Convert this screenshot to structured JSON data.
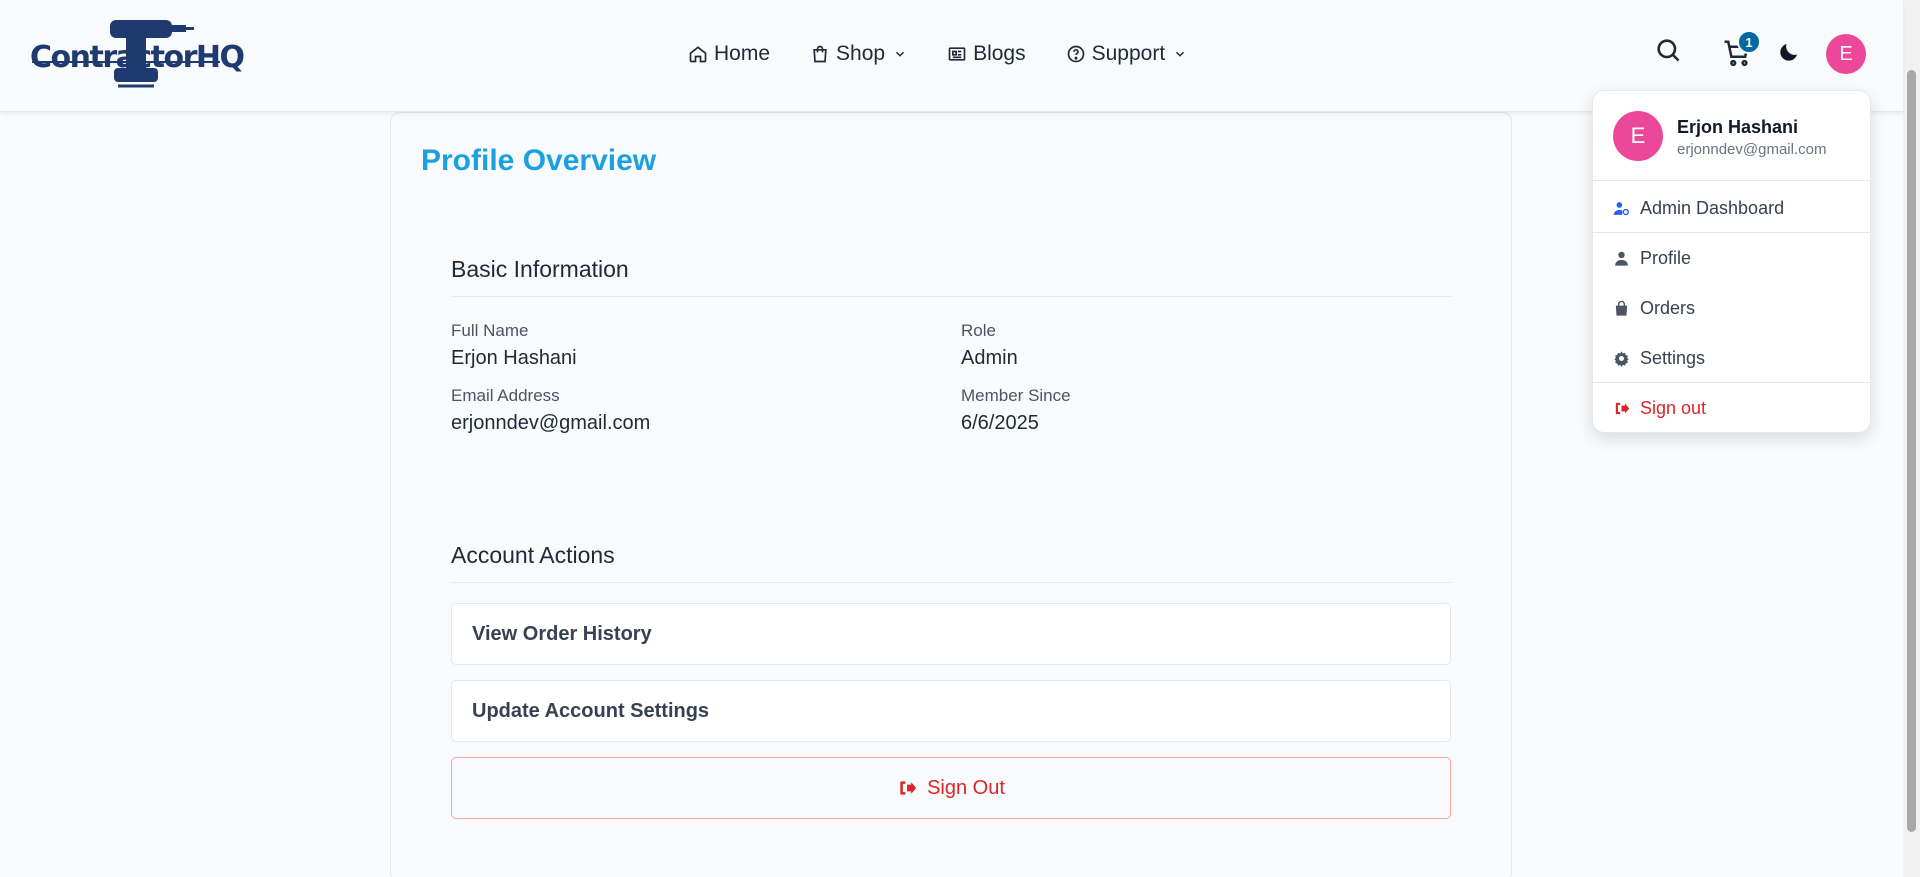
{
  "brand": {
    "logo_text": "ContractorHQ"
  },
  "nav": {
    "home": "Home",
    "shop": "Shop",
    "blogs": "Blogs",
    "support": "Support"
  },
  "header": {
    "cart_count": "1",
    "avatar_initial": "E"
  },
  "page": {
    "title": "Profile Overview",
    "basic_info": {
      "heading": "Basic Information",
      "full_name_label": "Full Name",
      "full_name": "Erjon Hashani",
      "role_label": "Role",
      "role": "Admin",
      "email_label": "Email Address",
      "email": "erjonndev@gmail.com",
      "member_since_label": "Member Since",
      "member_since": "6/6/2025"
    },
    "actions": {
      "heading": "Account Actions",
      "view_orders": "View Order History",
      "update_settings": "Update Account Settings",
      "sign_out": "Sign Out"
    }
  },
  "user_menu": {
    "initial": "E",
    "name": "Erjon Hashani",
    "email": "erjonndev@gmail.com",
    "items": {
      "admin": "Admin Dashboard",
      "profile": "Profile",
      "orders": "Orders",
      "settings": "Settings",
      "sign_out": "Sign out"
    }
  },
  "colors": {
    "accent": "#1ba1e2",
    "brand_navy": "#1e3a6e",
    "avatar": "#ec4899",
    "danger": "#dc2626",
    "badge": "#0369a1"
  }
}
